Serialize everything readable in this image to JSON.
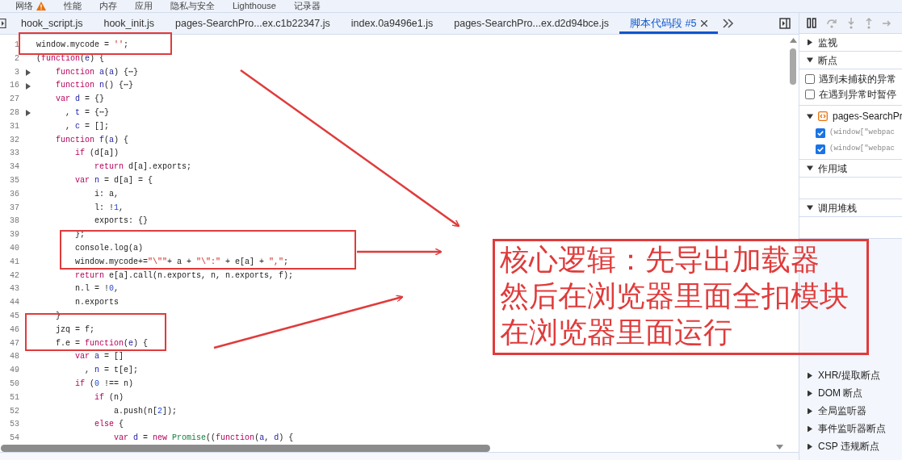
{
  "panel_tabs": [
    {
      "label": "网络",
      "warning": true
    },
    {
      "label": "性能",
      "warning": false
    },
    {
      "label": "内存",
      "warning": false
    },
    {
      "label": "应用",
      "warning": false
    },
    {
      "label": "隐私与安全",
      "warning": false
    },
    {
      "label": "Lighthouse",
      "warning": false
    },
    {
      "label": "记录器",
      "warning": false
    }
  ],
  "file_tabs": [
    {
      "label": "hook_script.js",
      "selected": false,
      "closable": false
    },
    {
      "label": "hook_init.js",
      "selected": false,
      "closable": false
    },
    {
      "label": "pages-SearchPro...ex.c1b22347.js",
      "selected": false,
      "closable": false
    },
    {
      "label": "index.0a9496e1.js",
      "selected": false,
      "closable": false
    },
    {
      "label": "pages-SearchPro...ex.d2d94bce.js",
      "selected": false,
      "closable": false
    },
    {
      "label": "脚本代码段 #5",
      "selected": true,
      "closable": true
    }
  ],
  "code_lines": [
    {
      "number": "1",
      "folded": false,
      "tokens": [
        {
          "text": "window.mycode = ",
          "kind": "plain"
        },
        {
          "text": "''",
          "kind": "str"
        },
        {
          "text": ";",
          "kind": "plain"
        }
      ]
    },
    {
      "number": "2",
      "folded": false,
      "tokens": [
        {
          "text": "(",
          "kind": "plain"
        },
        {
          "text": "function",
          "kind": "kw"
        },
        {
          "text": "(",
          "kind": "plain"
        },
        {
          "text": "e",
          "kind": "def"
        },
        {
          "text": ") {",
          "kind": "plain"
        }
      ]
    },
    {
      "number": "3",
      "folded": true,
      "tokens": [
        {
          "text": "    function ",
          "kind": "kw"
        },
        {
          "text": "a",
          "kind": "def"
        },
        {
          "text": "(",
          "kind": "plain"
        },
        {
          "text": "a",
          "kind": "def"
        },
        {
          "text": ") {⋯}",
          "kind": "plain"
        }
      ]
    },
    {
      "number": "16",
      "folded": true,
      "tokens": [
        {
          "text": "    function ",
          "kind": "kw"
        },
        {
          "text": "n",
          "kind": "def"
        },
        {
          "text": "() {⋯}",
          "kind": "plain"
        }
      ]
    },
    {
      "number": "27",
      "folded": false,
      "tokens": [
        {
          "text": "    var ",
          "kind": "kw"
        },
        {
          "text": "d",
          "kind": "def"
        },
        {
          "text": " = {}",
          "kind": "plain"
        }
      ]
    },
    {
      "number": "28",
      "folded": true,
      "tokens": [
        {
          "text": "      , ",
          "kind": "plain"
        },
        {
          "text": "t",
          "kind": "def"
        },
        {
          "text": " = {⋯}",
          "kind": "plain"
        }
      ]
    },
    {
      "number": "31",
      "folded": false,
      "tokens": [
        {
          "text": "      , ",
          "kind": "plain"
        },
        {
          "text": "c",
          "kind": "def"
        },
        {
          "text": " = [];",
          "kind": "plain"
        }
      ]
    },
    {
      "number": "32",
      "folded": false,
      "tokens": [
        {
          "text": "    function ",
          "kind": "kw"
        },
        {
          "text": "f",
          "kind": "def"
        },
        {
          "text": "(",
          "kind": "plain"
        },
        {
          "text": "a",
          "kind": "def"
        },
        {
          "text": ") {",
          "kind": "plain"
        }
      ]
    },
    {
      "number": "33",
      "folded": false,
      "tokens": [
        {
          "text": "        if",
          "kind": "kw"
        },
        {
          "text": " (d[a])",
          "kind": "plain"
        }
      ]
    },
    {
      "number": "34",
      "folded": false,
      "tokens": [
        {
          "text": "            return",
          "kind": "kw"
        },
        {
          "text": " d[a].exports;",
          "kind": "plain"
        }
      ]
    },
    {
      "number": "35",
      "folded": false,
      "tokens": [
        {
          "text": "        var ",
          "kind": "kw"
        },
        {
          "text": "n",
          "kind": "def"
        },
        {
          "text": " = d[a] = {",
          "kind": "plain"
        }
      ]
    },
    {
      "number": "36",
      "folded": false,
      "tokens": [
        {
          "text": "            i: a,",
          "kind": "plain"
        }
      ]
    },
    {
      "number": "37",
      "folded": false,
      "tokens": [
        {
          "text": "            l: !",
          "kind": "plain"
        },
        {
          "text": "1",
          "kind": "num"
        },
        {
          "text": ",",
          "kind": "plain"
        }
      ]
    },
    {
      "number": "38",
      "folded": false,
      "tokens": [
        {
          "text": "            exports: {}",
          "kind": "plain"
        }
      ]
    },
    {
      "number": "39",
      "folded": false,
      "tokens": [
        {
          "text": "        };",
          "kind": "plain"
        }
      ]
    },
    {
      "number": "40",
      "folded": false,
      "tokens": [
        {
          "text": "        console.log(a)",
          "kind": "plain"
        }
      ]
    },
    {
      "number": "41",
      "folded": false,
      "tokens": [
        {
          "text": "        window.mycode+=",
          "kind": "plain"
        },
        {
          "text": "\"\\\"\"",
          "kind": "str"
        },
        {
          "text": "+ a + ",
          "kind": "plain"
        },
        {
          "text": "\"\\\":\"",
          "kind": "str"
        },
        {
          "text": " + e[a] + ",
          "kind": "plain"
        },
        {
          "text": "\",\"",
          "kind": "str"
        },
        {
          "text": ";",
          "kind": "plain"
        }
      ]
    },
    {
      "number": "42",
      "folded": false,
      "tokens": [
        {
          "text": "        return",
          "kind": "kw"
        },
        {
          "text": " e[a].call(n.exports, n, n.exports, f);",
          "kind": "plain"
        }
      ]
    },
    {
      "number": "43",
      "folded": false,
      "tokens": [
        {
          "text": "        n.l = !",
          "kind": "plain"
        },
        {
          "text": "0",
          "kind": "num"
        },
        {
          "text": ",",
          "kind": "plain"
        }
      ]
    },
    {
      "number": "44",
      "folded": false,
      "tokens": [
        {
          "text": "        n.exports",
          "kind": "plain"
        }
      ]
    },
    {
      "number": "45",
      "folded": false,
      "tokens": [
        {
          "text": "    }",
          "kind": "plain"
        }
      ]
    },
    {
      "number": "46",
      "folded": false,
      "tokens": [
        {
          "text": "    jzq = f;",
          "kind": "plain"
        }
      ]
    },
    {
      "number": "47",
      "folded": false,
      "tokens": [
        {
          "text": "    f.e = ",
          "kind": "plain"
        },
        {
          "text": "function",
          "kind": "kw"
        },
        {
          "text": "(",
          "kind": "plain"
        },
        {
          "text": "e",
          "kind": "def"
        },
        {
          "text": ") {",
          "kind": "plain"
        }
      ]
    },
    {
      "number": "48",
      "folded": false,
      "tokens": [
        {
          "text": "        var ",
          "kind": "kw"
        },
        {
          "text": "a",
          "kind": "def"
        },
        {
          "text": " = []",
          "kind": "plain"
        }
      ]
    },
    {
      "number": "49",
      "folded": false,
      "tokens": [
        {
          "text": "          , ",
          "kind": "plain"
        },
        {
          "text": "n",
          "kind": "def"
        },
        {
          "text": " = t[e];",
          "kind": "plain"
        }
      ]
    },
    {
      "number": "50",
      "folded": false,
      "tokens": [
        {
          "text": "        if",
          "kind": "kw"
        },
        {
          "text": " (",
          "kind": "plain"
        },
        {
          "text": "0",
          "kind": "num"
        },
        {
          "text": " !== n)",
          "kind": "plain"
        }
      ]
    },
    {
      "number": "51",
      "folded": false,
      "tokens": [
        {
          "text": "            if",
          "kind": "kw"
        },
        {
          "text": " (n)",
          "kind": "plain"
        }
      ]
    },
    {
      "number": "52",
      "folded": false,
      "tokens": [
        {
          "text": "                a.push(n[",
          "kind": "plain"
        },
        {
          "text": "2",
          "kind": "num"
        },
        {
          "text": "]);",
          "kind": "plain"
        }
      ]
    },
    {
      "number": "53",
      "folded": false,
      "tokens": [
        {
          "text": "            else",
          "kind": "kw"
        },
        {
          "text": " {",
          "kind": "plain"
        }
      ]
    },
    {
      "number": "54",
      "folded": false,
      "tokens": [
        {
          "text": "                var ",
          "kind": "kw"
        },
        {
          "text": "d",
          "kind": "def"
        },
        {
          "text": " = ",
          "kind": "plain"
        },
        {
          "text": "new ",
          "kind": "kw"
        },
        {
          "text": "Promise",
          "kind": "cls"
        },
        {
          "text": "((",
          "kind": "plain"
        },
        {
          "text": "function",
          "kind": "kw"
        },
        {
          "text": "(",
          "kind": "plain"
        },
        {
          "text": "a",
          "kind": "def"
        },
        {
          "text": ", ",
          "kind": "plain"
        },
        {
          "text": "d",
          "kind": "def"
        },
        {
          "text": ") {",
          "kind": "plain"
        }
      ]
    }
  ],
  "annotation": {
    "lines": [
      "核心逻辑：先导出加载器",
      "然后在浏览器里面全扣模块",
      "在浏览器里面运行"
    ]
  },
  "sidebar": {
    "top_sections": [
      {
        "title": "监视",
        "expanded": false
      },
      {
        "title": "断点",
        "expanded": true,
        "options": [
          {
            "label": "遇到未捕获的异常",
            "checked": false
          },
          {
            "label": "在遇到异常时暂停",
            "checked": false
          }
        ],
        "files": [
          {
            "name": "pages-SearchPr",
            "expanded": true,
            "breakpoints": [
              {
                "code": "(window[\"webpac",
                "checked": true
              },
              {
                "code": "(window[\"webpac",
                "checked": true
              }
            ]
          }
        ]
      },
      {
        "title": "作用域",
        "expanded": true
      },
      {
        "title": "调用堆栈",
        "expanded": true
      }
    ],
    "bottom_sections": [
      {
        "title": "XHR/提取断点",
        "expanded": false
      },
      {
        "title": "DOM 断点",
        "expanded": false
      },
      {
        "title": "全局监听器",
        "expanded": false
      },
      {
        "title": "事件监听器断点",
        "expanded": false
      },
      {
        "title": "CSP 违规断点",
        "expanded": false
      }
    ]
  }
}
